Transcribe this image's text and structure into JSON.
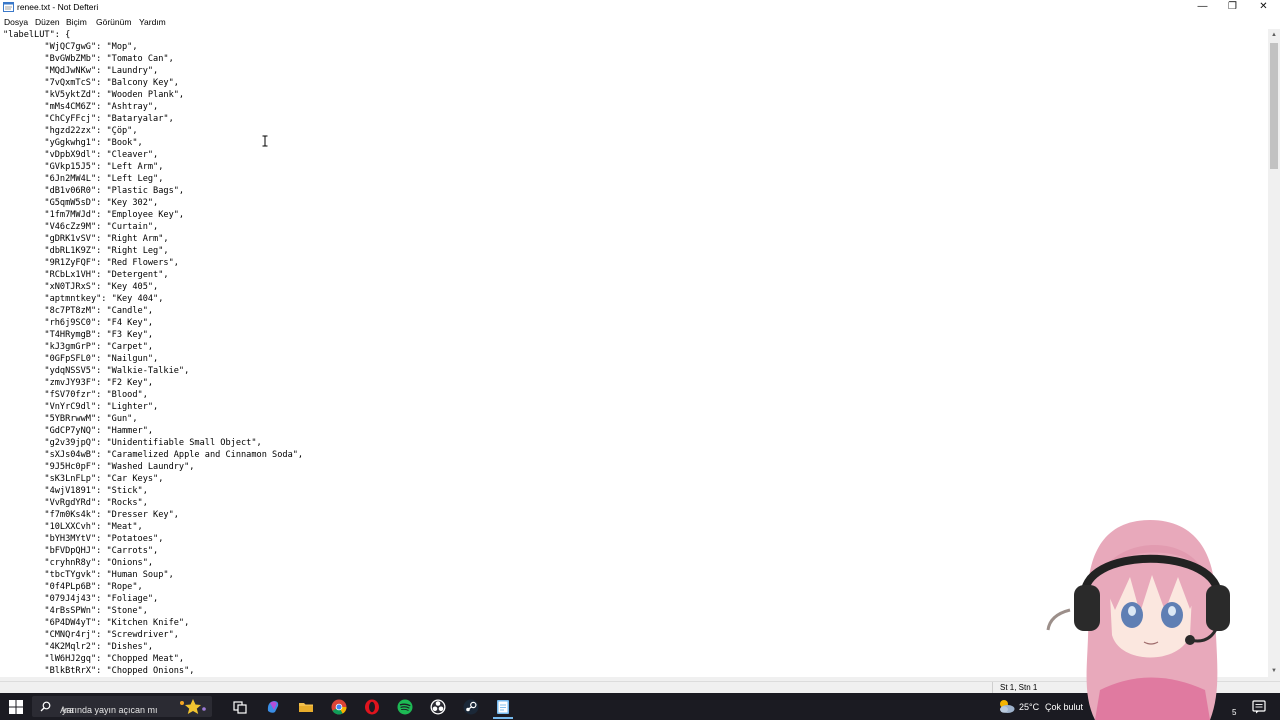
{
  "window": {
    "title": "renee.txt - Not Defteri",
    "controls": {
      "minimize": "—",
      "maximize": "❐",
      "close": "✕"
    }
  },
  "menu": [
    "Dosya",
    "Düzen",
    "Biçim",
    "Görünüm",
    "Yardım"
  ],
  "editor": {
    "lines": [
      "\"labelLUT\": {",
      "        \"WjQC7gwG\": \"Mop\",",
      "        \"BvGWbZMb\": \"Tomato Can\",",
      "        \"MQdJwNKw\": \"Laundry\",",
      "        \"7vQxmTcS\": \"Balcony Key\",",
      "        \"kV5yktZd\": \"Wooden Plank\",",
      "        \"mMs4CM6Z\": \"Ashtray\",",
      "        \"ChCyFFcj\": \"Bataryalar\",",
      "        \"hgzd22zx\": \"Çöp\",",
      "        \"yGgkwhg1\": \"Book\",",
      "        \"vDpbX9dl\": \"Cleaver\",",
      "        \"GVkp15J5\": \"Left Arm\",",
      "        \"6Jn2MW4L\": \"Left Leg\",",
      "        \"dB1v06R0\": \"Plastic Bags\",",
      "        \"G5qmW5sD\": \"Key 302\",",
      "        \"1fm7MWJd\": \"Employee Key\",",
      "        \"V46cZz9M\": \"Curtain\",",
      "        \"gDRK1vSV\": \"Right Arm\",",
      "        \"dbRL1K9Z\": \"Right Leg\",",
      "        \"9R1ZyFQF\": \"Red Flowers\",",
      "        \"RCbLx1VH\": \"Detergent\",",
      "        \"xN0TJRxS\": \"Key 405\",",
      "        \"aptmntkey\": \"Key 404\",",
      "        \"8c7PT8zM\": \"Candle\",",
      "        \"rh6j9SC0\": \"F4 Key\",",
      "        \"T4HRymgB\": \"F3 Key\",",
      "        \"kJ3gmGrP\": \"Carpet\",",
      "        \"0GFpSFL0\": \"Nailgun\",",
      "        \"ydqNSSV5\": \"Walkie-Talkie\",",
      "        \"zmvJY93F\": \"F2 Key\",",
      "        \"fSV70fzr\": \"Blood\",",
      "        \"VnYrC9dl\": \"Lighter\",",
      "        \"5YBRrwwM\": \"Gun\",",
      "        \"GdCP7yNQ\": \"Hammer\",",
      "        \"g2v39jpQ\": \"Unidentifiable Small Object\",",
      "        \"sXJs04wB\": \"Caramelized Apple and Cinnamon Soda\",",
      "        \"9J5Hc0pF\": \"Washed Laundry\",",
      "        \"sK3LnFLp\": \"Car Keys\",",
      "        \"4wjV1891\": \"Stick\",",
      "        \"VvRgdYRd\": \"Rocks\",",
      "        \"f7m0Ks4k\": \"Dresser Key\",",
      "        \"10LXXCvh\": \"Meat\",",
      "        \"bYH3MYtV\": \"Potatoes\",",
      "        \"bFVDpQHJ\": \"Carrots\",",
      "        \"cryhnR8y\": \"Onions\",",
      "        \"tbcTYgvk\": \"Human Soup\",",
      "        \"0f4PLp6B\": \"Rope\",",
      "        \"079J4j43\": \"Foliage\",",
      "        \"4rBsSPWn\": \"Stone\",",
      "        \"6P4DW4yT\": \"Kitchen Knife\",",
      "        \"CMNQr4rj\": \"Screwdriver\",",
      "        \"4K2Mqlr2\": \"Dishes\",",
      "        \"lW6HJ2gq\": \"Chopped Meat\",",
      "        \"BlkBtRrX\": \"Chopped Onions\","
    ]
  },
  "status": {
    "position": "St 1, Stn 1"
  },
  "taskbar": {
    "search_placeholder": "Ara",
    "search_overlay": "yarında yayın açıcan mı",
    "weather_temp": "25°C",
    "weather_desc": "Çok bulut",
    "clock_fragment": "5"
  },
  "colors": {
    "taskbar": "#1b1b22",
    "scroll_thumb": "#c2c2c2",
    "status_bar": "#f0f0f0",
    "spotify": "#1db954",
    "opera": "#e0141e",
    "notepad_blue": "#76b9ed"
  }
}
